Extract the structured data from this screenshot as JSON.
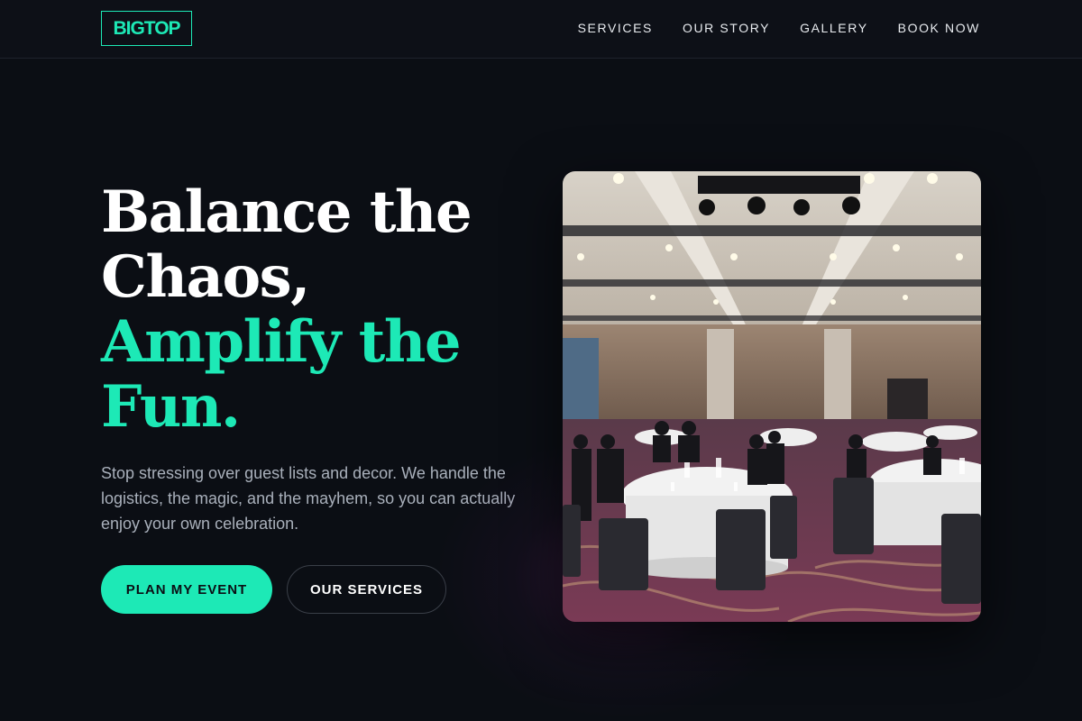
{
  "brand": {
    "logo_text": "BIGTOP",
    "accent_color": "#1de9b6"
  },
  "nav": {
    "links": [
      {
        "label": "SERVICES"
      },
      {
        "label": "OUR STORY"
      },
      {
        "label": "GALLERY"
      },
      {
        "label": "BOOK NOW"
      }
    ]
  },
  "hero": {
    "headline_line1": "Balance the",
    "headline_line2": "Chaos,",
    "headline_line3": "Amplify the",
    "headline_line4": "Fun.",
    "lead": "Stop stressing over guest lists and decor. We handle the logistics, the magic, and the mayhem, so you can actually enjoy your own celebration.",
    "primary_button": "PLAN MY EVENT",
    "secondary_button": "OUR SERVICES",
    "image_subject": "banquet-hall-photo"
  }
}
